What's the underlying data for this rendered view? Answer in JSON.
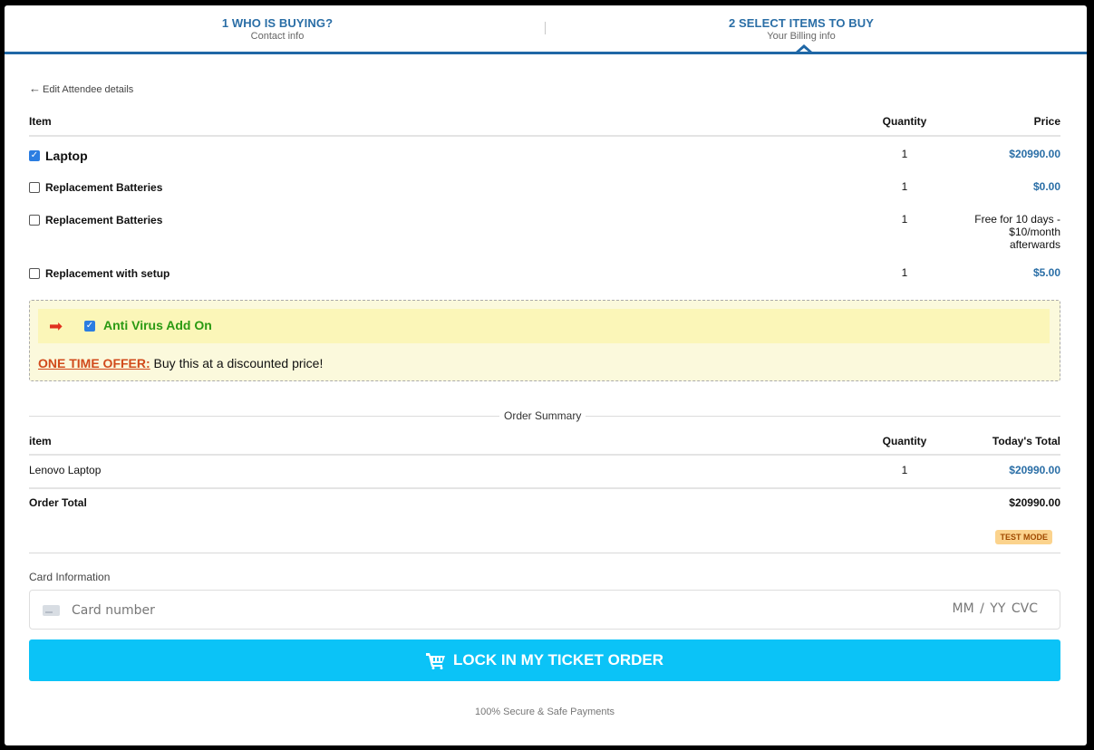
{
  "steps": [
    {
      "title": "1 WHO IS BUYING?",
      "subtitle": "Contact info"
    },
    {
      "title": "2 SELECT ITEMS TO BUY",
      "subtitle": "Your Billing info"
    }
  ],
  "back_link": "Edit Attendee details",
  "items_table": {
    "headers": {
      "item": "Item",
      "quantity": "Quantity",
      "price": "Price"
    },
    "rows": [
      {
        "name": "Laptop",
        "checked": true,
        "quantity": "1",
        "price": "$20990.00"
      },
      {
        "name": "Replacement Batteries",
        "checked": false,
        "quantity": "1",
        "price": "$0.00"
      },
      {
        "name": "Replacement Batteries",
        "checked": false,
        "quantity": "1",
        "price_lines": [
          "Free for 10 days -",
          "$10/month",
          "afterwards"
        ]
      },
      {
        "name": "Replacement with setup",
        "checked": false,
        "quantity": "1",
        "price": "$5.00"
      }
    ]
  },
  "offer": {
    "title": "Anti Virus Add On",
    "checked": true,
    "highlight": "ONE TIME OFFER:",
    "text": " Buy this at a discounted price!"
  },
  "summary": {
    "label": "Order Summary",
    "headers": {
      "item": "item",
      "quantity": "Quantity",
      "total": "Today's Total"
    },
    "rows": [
      {
        "name": "Lenovo Laptop",
        "quantity": "1",
        "total": "$20990.00"
      }
    ],
    "order_total_label": "Order Total",
    "order_total_value": "$20990.00",
    "badge": "TEST MODE"
  },
  "card": {
    "label": "Card Information",
    "placeholder": "Card number",
    "expiry": "MM / YY",
    "cvc": "CVC"
  },
  "submit_label": "LOCK IN MY TICKET ORDER",
  "secure_text": "100% Secure & Safe Payments",
  "colors": {
    "accent": "#2a6ea6",
    "button": "#0bc3f7",
    "offer_green": "#2a9a12",
    "offer_red": "#d14a1b"
  }
}
